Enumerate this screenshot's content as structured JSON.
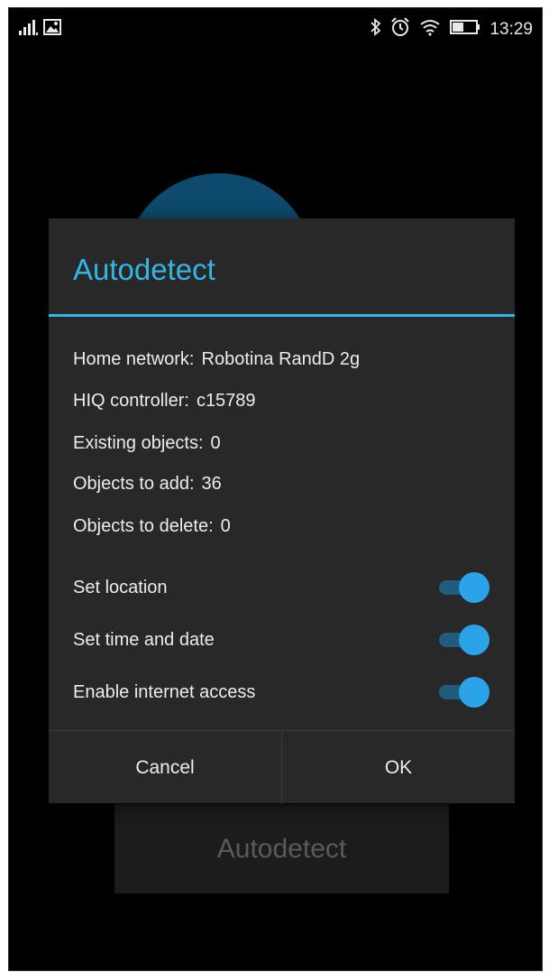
{
  "status_bar": {
    "time": "13:29",
    "icons": [
      "signal-icon",
      "image-notification-icon",
      "bluetooth-icon",
      "alarm-icon",
      "wifi-icon",
      "battery-icon"
    ]
  },
  "background": {
    "button_label": "Autodetect"
  },
  "dialog": {
    "title": "Autodetect",
    "info": [
      {
        "label": "Home network:",
        "value": "Robotina RandD 2g"
      },
      {
        "label": "HIQ controller:",
        "value": "c15789"
      },
      {
        "label": "Existing objects:",
        "value": "0"
      },
      {
        "label": "Objects to add:",
        "value": "36"
      },
      {
        "label": "Objects to delete:",
        "value": "0"
      }
    ],
    "switches": [
      {
        "label": "Set location",
        "on": true
      },
      {
        "label": "Set time and date",
        "on": true
      },
      {
        "label": "Enable internet access",
        "on": true
      }
    ],
    "cancel_label": "Cancel",
    "ok_label": "OK"
  },
  "colors": {
    "accent": "#33b5e5",
    "dialog_bg": "#282828",
    "switch_thumb": "#2ba3e9",
    "switch_track": "#1f5c7d"
  }
}
